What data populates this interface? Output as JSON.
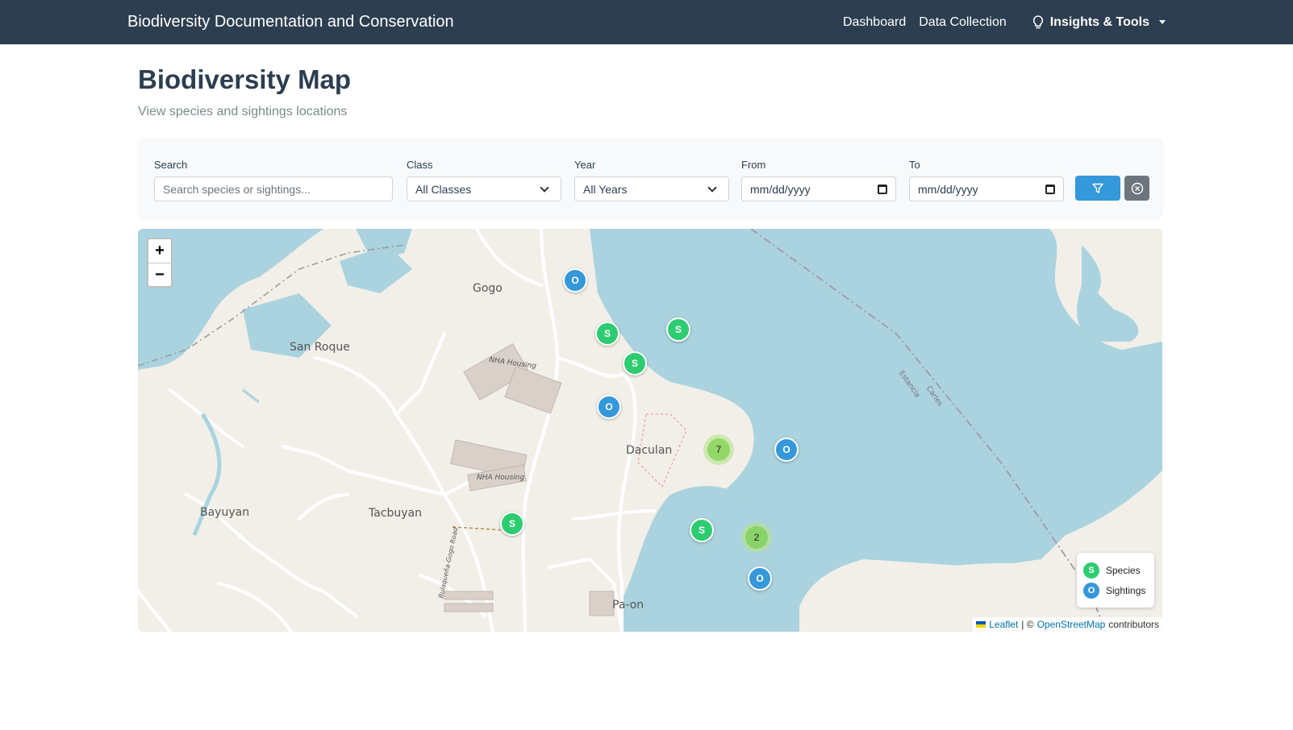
{
  "navbar": {
    "brand": "Biodiversity Documentation and Conservation",
    "links": [
      "Dashboard",
      "Data Collection"
    ],
    "dropdown_label": "Insights & Tools",
    "dropdown_icon": "lightbulb-icon"
  },
  "header": {
    "title": "Biodiversity Map",
    "subtitle": "View species and sightings locations"
  },
  "filters": {
    "search": {
      "label": "Search",
      "placeholder": "Search species or sightings..."
    },
    "class": {
      "label": "Class",
      "selected": "All Classes"
    },
    "year": {
      "label": "Year",
      "selected": "All Years"
    },
    "from": {
      "label": "From",
      "placeholder": "mm/dd/yyyy"
    },
    "to": {
      "label": "To",
      "placeholder": "mm/dd/yyyy"
    },
    "filter_button_icon": "filter-icon",
    "clear_button_icon": "clear-icon"
  },
  "map": {
    "zoom_in": "+",
    "zoom_out": "−",
    "places": [
      "Gogo",
      "San Roque",
      "Daculan",
      "Bayuyan",
      "Tacbuyan",
      "Pa-on",
      "NHA Housing",
      "NHA Housing",
      "Bulaqueña-Gogo Road",
      "Estancia",
      "Carles"
    ],
    "markers": [
      {
        "type": "O",
        "kind": "sighting"
      },
      {
        "type": "S",
        "kind": "species"
      },
      {
        "type": "S",
        "kind": "species"
      },
      {
        "type": "S",
        "kind": "species"
      },
      {
        "type": "O",
        "kind": "sighting"
      },
      {
        "type": "O",
        "kind": "sighting"
      },
      {
        "type": "S",
        "kind": "species"
      },
      {
        "type": "S",
        "kind": "species"
      },
      {
        "type": "O",
        "kind": "sighting"
      }
    ],
    "clusters": [
      "7",
      "2"
    ],
    "legend": {
      "species": {
        "letter": "S",
        "label": "Species",
        "color": "#2ecc71"
      },
      "sightings": {
        "letter": "O",
        "label": "Sightings",
        "color": "#3498db"
      }
    },
    "attribution": {
      "leaflet": "Leaflet",
      "separator": "| ©",
      "osm": "OpenStreetMap",
      "suffix": "contributors"
    },
    "colors": {
      "water": "#aad3df",
      "land": "#f2efe9"
    }
  }
}
